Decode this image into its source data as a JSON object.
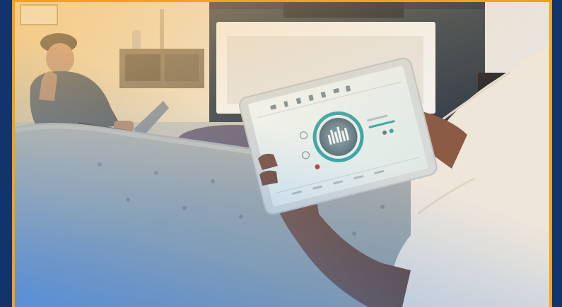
{
  "image": {
    "description_free": true,
    "colors": {
      "frame": "#12346c",
      "border_accent": "#f3a21e",
      "wall": "#e9ddc8",
      "sofa": "#a7a9a6",
      "sweater": "#efe7dc",
      "tablet_screen": "#e4ece8",
      "ui_teal": "#3ea6a4"
    },
    "icons": [
      "home-screen-icon",
      "equalizer-icon",
      "power-icon",
      "volume-icon"
    ]
  }
}
